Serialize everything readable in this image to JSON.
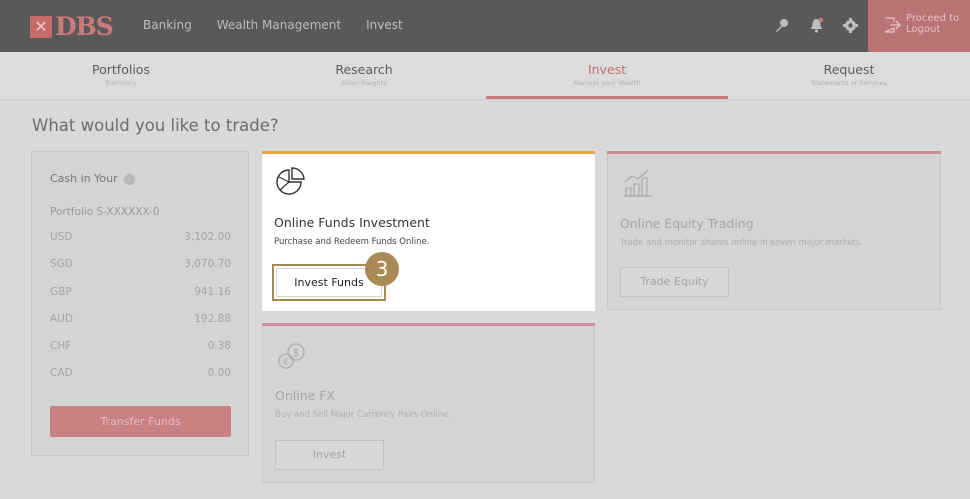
{
  "header": {
    "logo_text": "DBS",
    "nav": [
      "Banking",
      "Wealth Management",
      "Invest"
    ],
    "logout": {
      "line1": "Proceed to",
      "line2": "Logout"
    }
  },
  "tabs": [
    {
      "title": "Portfolios",
      "subtitle": "Summary"
    },
    {
      "title": "Research",
      "subtitle": "Asian Insights"
    },
    {
      "title": "Invest",
      "subtitle": "Manage your Wealth"
    },
    {
      "title": "Request",
      "subtitle": "Statements or Services"
    }
  ],
  "page_heading": "What would you like to trade?",
  "cash": {
    "title": "Cash in Your",
    "info": "i",
    "portfolio": "Portfolio S-XXXXXX-0",
    "rows": [
      {
        "currency": "USD",
        "value": "3,102.00"
      },
      {
        "currency": "SGD",
        "value": "3,070.70"
      },
      {
        "currency": "GBP",
        "value": "941.16"
      },
      {
        "currency": "AUD",
        "value": "192.88"
      },
      {
        "currency": "CHF",
        "value": "0.38"
      },
      {
        "currency": "CAD",
        "value": "0.00"
      }
    ],
    "button": "Transfer Funds"
  },
  "funds": {
    "title": "Online Funds Investment",
    "description": "Purchase and Redeem Funds Online.",
    "button": "Invest Funds"
  },
  "equity": {
    "title": "Online Equity Trading",
    "description": "Trade and monitor shares online in seven major markets.",
    "button": "Trade Equity"
  },
  "fx": {
    "title": "Online FX",
    "description": "Buy and Sell Major Currency Pairs Online.",
    "button": "Invest"
  },
  "step_badge": "3",
  "colors": {
    "brand": "#c86a6a",
    "funds_accent": "#e8a84a",
    "highlight": "#a98a55"
  }
}
